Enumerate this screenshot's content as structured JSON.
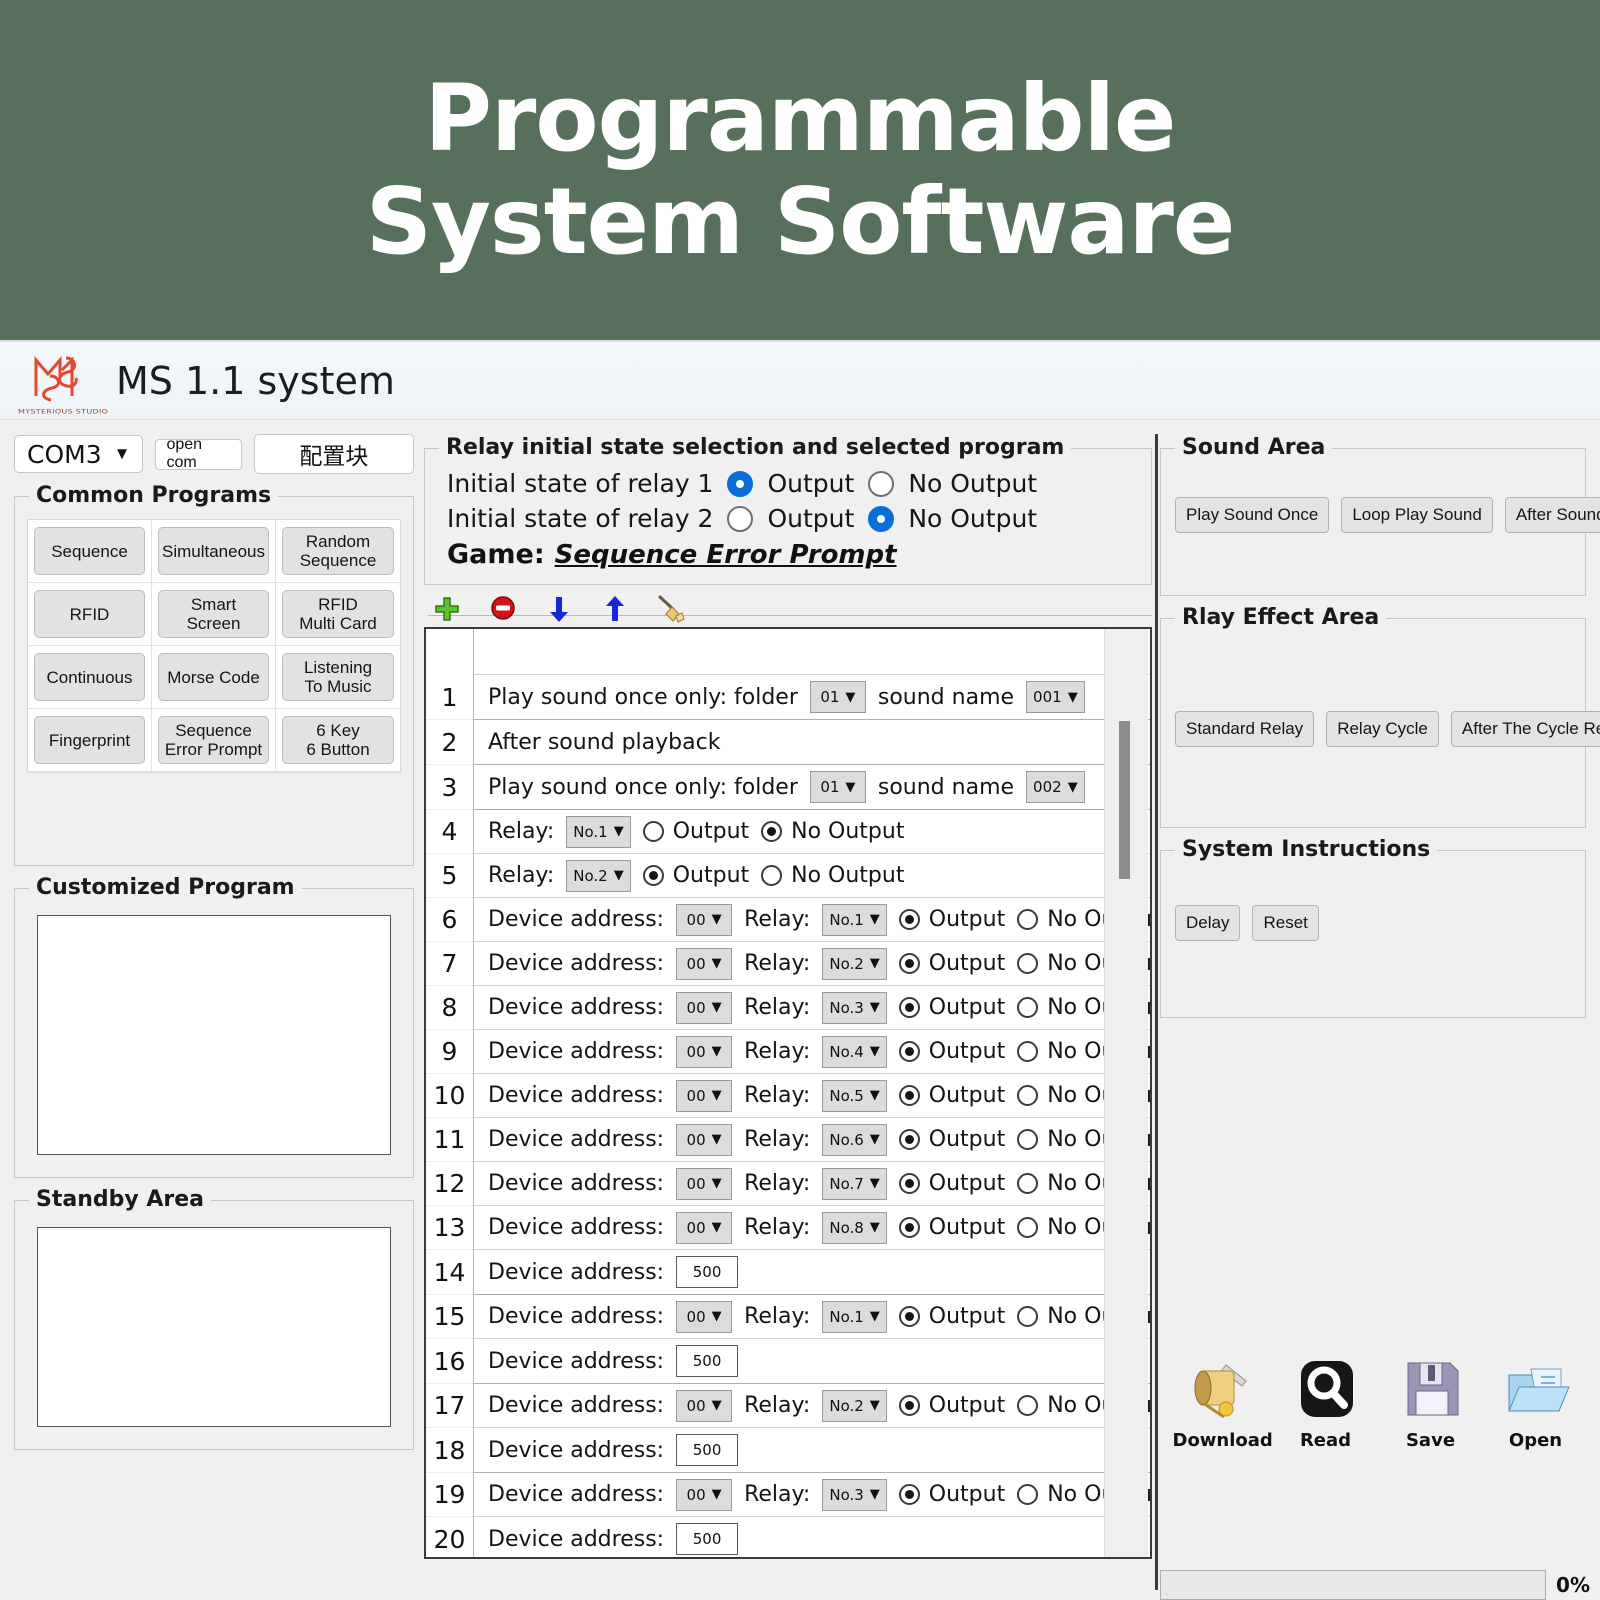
{
  "banner": {
    "line1": "Programmable",
    "line2": "System Software"
  },
  "header": {
    "title": "MS 1.1 system",
    "logo_caption": "MYSTERIOUS STUDIO"
  },
  "toolbar_top": {
    "port_value": "COM3",
    "open_com_label": "open com",
    "config_label": "配置块"
  },
  "common_programs": {
    "title": "Common Programs",
    "buttons": [
      "Sequence",
      "Simultaneous",
      "Random\nSequence",
      "RFID",
      "Smart\nScreen",
      "RFID\nMulti Card",
      "Continuous",
      "Morse Code",
      "Listening\nTo Music",
      "Fingerprint",
      "Sequence\nError Prompt",
      "6 Key\n6 Button"
    ]
  },
  "customized_program": {
    "title": "Customized Program"
  },
  "standby_area": {
    "title": "Standby Area"
  },
  "relay_panel": {
    "title": "Relay initial state selection and selected program",
    "relay1_label": "Initial state of relay 1",
    "relay1_output": "Output",
    "relay1_no_output": "No Output",
    "relay1_selected": "Output",
    "relay2_label": "Initial state of relay 2",
    "relay2_output": "Output",
    "relay2_no_output": "No Output",
    "relay2_selected": "No Output",
    "game_label": "Game:",
    "game_value": "Sequence Error Prompt"
  },
  "list_toolbar": {
    "icons": [
      "add-icon",
      "delete-icon",
      "move-down-icon",
      "move-up-icon",
      "clear-icon"
    ]
  },
  "program_list": {
    "rows": [
      {
        "n": "1",
        "type": "sound",
        "label": "Play sound once only: folder",
        "folder": "01",
        "name_label": "sound name",
        "sound": "001"
      },
      {
        "n": "2",
        "type": "text",
        "label": "After sound playback"
      },
      {
        "n": "3",
        "type": "sound",
        "label": "Play sound once only: folder",
        "folder": "01",
        "name_label": "sound name",
        "sound": "002"
      },
      {
        "n": "4",
        "type": "relay",
        "label": "Relay:",
        "relay": "No.1",
        "output": "Output",
        "no_output": "No Output",
        "selected": "No Output"
      },
      {
        "n": "5",
        "type": "relay",
        "label": "Relay:",
        "relay": "No.2",
        "output": "Output",
        "no_output": "No Output",
        "selected": "Output"
      },
      {
        "n": "6",
        "type": "device",
        "label": "Device address:",
        "addr": "00",
        "relay_label": "Relay:",
        "relay": "No.1",
        "output": "Output",
        "no_output": "No Output",
        "selected": "Output"
      },
      {
        "n": "7",
        "type": "device",
        "label": "Device address:",
        "addr": "00",
        "relay_label": "Relay:",
        "relay": "No.2",
        "output": "Output",
        "no_output": "No Output",
        "selected": "Output"
      },
      {
        "n": "8",
        "type": "device",
        "label": "Device address:",
        "addr": "00",
        "relay_label": "Relay:",
        "relay": "No.3",
        "output": "Output",
        "no_output": "No Output",
        "selected": "Output"
      },
      {
        "n": "9",
        "type": "device",
        "label": "Device address:",
        "addr": "00",
        "relay_label": "Relay:",
        "relay": "No.4",
        "output": "Output",
        "no_output": "No Output",
        "selected": "Output"
      },
      {
        "n": "10",
        "type": "device",
        "label": "Device address:",
        "addr": "00",
        "relay_label": "Relay:",
        "relay": "No.5",
        "output": "Output",
        "no_output": "No Output",
        "selected": "Output"
      },
      {
        "n": "11",
        "type": "device",
        "label": "Device address:",
        "addr": "00",
        "relay_label": "Relay:",
        "relay": "No.6",
        "output": "Output",
        "no_output": "No Output",
        "selected": "Output"
      },
      {
        "n": "12",
        "type": "device",
        "label": "Device address:",
        "addr": "00",
        "relay_label": "Relay:",
        "relay": "No.7",
        "output": "Output",
        "no_output": "No Output",
        "selected": "Output"
      },
      {
        "n": "13",
        "type": "device",
        "label": "Device address:",
        "addr": "00",
        "relay_label": "Relay:",
        "relay": "No.8",
        "output": "Output",
        "no_output": "No Output",
        "selected": "Output"
      },
      {
        "n": "14",
        "type": "delay",
        "label": "Device address:",
        "value": "500"
      },
      {
        "n": "15",
        "type": "device",
        "label": "Device address:",
        "addr": "00",
        "relay_label": "Relay:",
        "relay": "No.1",
        "output": "Output",
        "no_output": "No Output",
        "selected": "Output"
      },
      {
        "n": "16",
        "type": "delay",
        "label": "Device address:",
        "value": "500"
      },
      {
        "n": "17",
        "type": "device",
        "label": "Device address:",
        "addr": "00",
        "relay_label": "Relay:",
        "relay": "No.2",
        "output": "Output",
        "no_output": "No Output",
        "selected": "Output"
      },
      {
        "n": "18",
        "type": "delay",
        "label": "Device address:",
        "value": "500"
      },
      {
        "n": "19",
        "type": "device",
        "label": "Device address:",
        "addr": "00",
        "relay_label": "Relay:",
        "relay": "No.3",
        "output": "Output",
        "no_output": "No Output",
        "selected": "Output"
      },
      {
        "n": "20",
        "type": "delay",
        "label": "Device address:",
        "value": "500"
      }
    ]
  },
  "sound_area": {
    "title": "Sound Area",
    "buttons": [
      "Play Sound Once",
      "Loop Play Sound",
      "After Sound Play"
    ]
  },
  "relay_effect_area": {
    "title": "Rlay Effect Area",
    "buttons": [
      "Standard Relay",
      "Relay Cycle",
      "After The Cycle Relay"
    ]
  },
  "system_instructions": {
    "title": "System Instructions",
    "buttons": [
      "Delay",
      "Reset"
    ]
  },
  "action_icons": [
    {
      "label": "Download",
      "icon": "scroll-quill-icon"
    },
    {
      "label": "Read",
      "icon": "magnifier-icon"
    },
    {
      "label": "Save",
      "icon": "floppy-disk-icon"
    },
    {
      "label": "Open",
      "icon": "open-folder-icon"
    }
  ],
  "progress": {
    "percent": "0%"
  },
  "colors": {
    "banner": "#56705c",
    "accent": "#0a6ed8",
    "logo": "#e04a2f"
  }
}
